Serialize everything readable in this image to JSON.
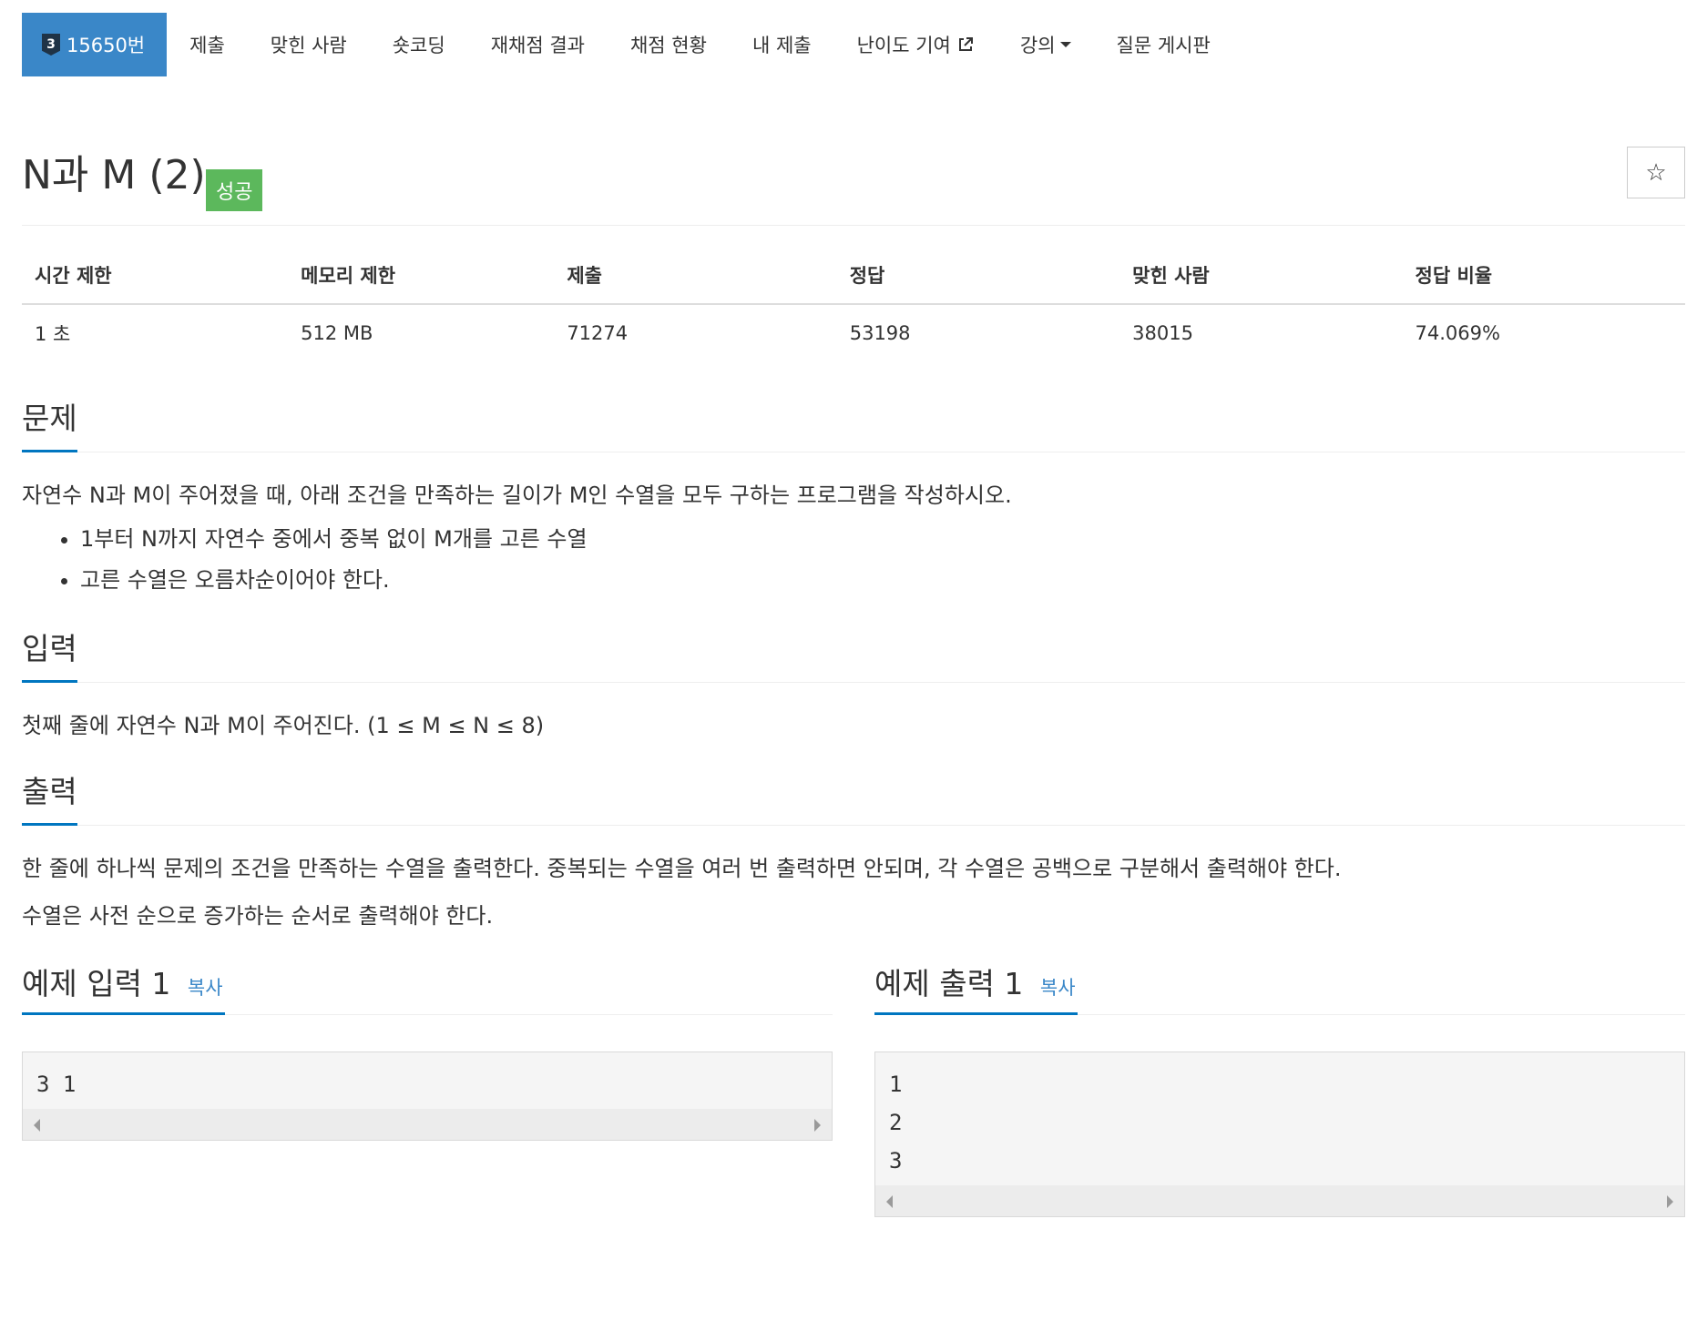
{
  "nav": {
    "tier": "3",
    "problem_tab": "15650번",
    "items": [
      "제출",
      "맞힌 사람",
      "숏코딩",
      "재채점 결과",
      "채점 현황",
      "내 제출",
      "난이도 기여",
      "강의",
      "질문 게시판"
    ]
  },
  "problem": {
    "title": "N과 M (2)",
    "status": "성공",
    "star": "☆"
  },
  "info": {
    "headers": [
      "시간 제한",
      "메모리 제한",
      "제출",
      "정답",
      "맞힌 사람",
      "정답 비율"
    ],
    "values": [
      "1 초",
      "512 MB",
      "71274",
      "53198",
      "38015",
      "74.069%"
    ]
  },
  "description": {
    "title": "문제",
    "text": "자연수 N과 M이 주어졌을 때, 아래 조건을 만족하는 길이가 M인 수열을 모두 구하는 프로그램을 작성하시오.",
    "bullets": [
      "1부터 N까지 자연수 중에서 중복 없이 M개를 고른 수열",
      "고른 수열은 오름차순이어야 한다."
    ]
  },
  "input": {
    "title": "입력",
    "text": "첫째 줄에 자연수 N과 M이 주어진다. (1 ≤ M ≤ N ≤ 8)"
  },
  "output": {
    "title": "출력",
    "text1": "한 줄에 하나씩 문제의 조건을 만족하는 수열을 출력한다. 중복되는 수열을 여러 번 출력하면 안되며, 각 수열은 공백으로 구분해서 출력해야 한다.",
    "text2": "수열은 사전 순으로 증가하는 순서로 출력해야 한다."
  },
  "samples": {
    "input_title": "예제 입력 1",
    "output_title": "예제 출력 1",
    "copy_label": "복사",
    "input_text": "3 1",
    "output_text": "1\n2\n3"
  },
  "colors": {
    "active_tab": "#3a87c8",
    "status_badge": "#5cb85c",
    "section_underline": "#0076c0",
    "link": "#3a87c8"
  }
}
